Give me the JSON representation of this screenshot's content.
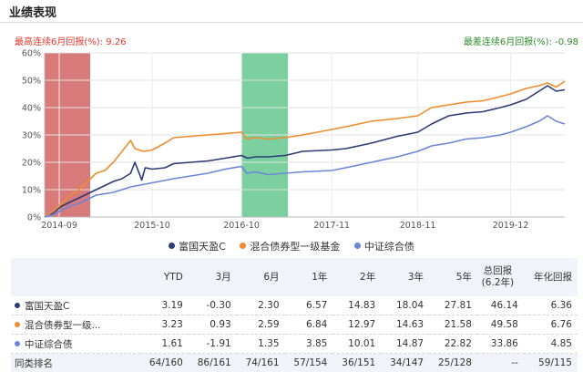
{
  "section_title": "业绩表现",
  "best_streak": {
    "label": "最高连续6月回报(%):",
    "value": "9.26"
  },
  "worst_streak": {
    "label": "最差连续6月回报(%):",
    "value": "-0.98"
  },
  "colors": {
    "fund": "#2c3a75",
    "category": "#f08c2e",
    "index": "#6b86d6",
    "best_band": "#d97a7a",
    "worst_band": "#7ccf9f"
  },
  "chart_data": {
    "type": "line",
    "title": "",
    "xlabel": "",
    "ylabel": "",
    "xlim": [
      2014.5,
      2020.55
    ],
    "ylim": [
      0,
      60
    ],
    "y_ticks": [
      0,
      10,
      20,
      30,
      40,
      50,
      60
    ],
    "y_tick_labels": [
      "0%",
      "10%",
      "20%",
      "30%",
      "40%",
      "50%",
      "60%"
    ],
    "x_ticks": [
      2014.67,
      2015.75,
      2016.79,
      2017.84,
      2018.84,
      2019.92
    ],
    "x_tick_labels": [
      "2014-09",
      "2015-10",
      "2016-10",
      "2017-11",
      "2018-11",
      "2019-12"
    ],
    "grid": true,
    "legend_position": "bottom",
    "highlight_bands": [
      {
        "kind": "best",
        "x_start": 2014.5,
        "x_end": 2015.03
      },
      {
        "kind": "worst",
        "x_start": 2016.79,
        "x_end": 2017.33
      }
    ],
    "series": [
      {
        "name": "富国天盈C",
        "color_key": "fund",
        "points": [
          [
            2014.5,
            0
          ],
          [
            2014.6,
            1.5
          ],
          [
            2014.7,
            4
          ],
          [
            2014.8,
            5.5
          ],
          [
            2014.9,
            7
          ],
          [
            2015.0,
            8.5
          ],
          [
            2015.1,
            10
          ],
          [
            2015.2,
            11.5
          ],
          [
            2015.3,
            13
          ],
          [
            2015.4,
            14
          ],
          [
            2015.5,
            16
          ],
          [
            2015.55,
            20
          ],
          [
            2015.6,
            16
          ],
          [
            2015.63,
            13.5
          ],
          [
            2015.67,
            18
          ],
          [
            2015.75,
            17.5
          ],
          [
            2015.9,
            18
          ],
          [
            2016.0,
            19.5
          ],
          [
            2016.2,
            20
          ],
          [
            2016.4,
            20.5
          ],
          [
            2016.6,
            21.5
          ],
          [
            2016.79,
            22.5
          ],
          [
            2016.86,
            21.5
          ],
          [
            2016.95,
            22
          ],
          [
            2017.1,
            22
          ],
          [
            2017.3,
            22.5
          ],
          [
            2017.5,
            24
          ],
          [
            2017.84,
            24.5
          ],
          [
            2018.0,
            25
          ],
          [
            2018.3,
            27
          ],
          [
            2018.6,
            29.5
          ],
          [
            2018.84,
            31
          ],
          [
            2019.0,
            34
          ],
          [
            2019.2,
            37
          ],
          [
            2019.4,
            38
          ],
          [
            2019.6,
            38.5
          ],
          [
            2019.8,
            40
          ],
          [
            2019.92,
            41
          ],
          [
            2020.1,
            43
          ],
          [
            2020.25,
            46
          ],
          [
            2020.35,
            48
          ],
          [
            2020.45,
            46
          ],
          [
            2020.55,
            46.5
          ]
        ]
      },
      {
        "name": "混合债券型一级基金",
        "color_key": "category",
        "points": [
          [
            2014.5,
            0
          ],
          [
            2014.6,
            2
          ],
          [
            2014.7,
            5
          ],
          [
            2014.8,
            8
          ],
          [
            2014.9,
            10
          ],
          [
            2015.0,
            13
          ],
          [
            2015.1,
            16
          ],
          [
            2015.2,
            17
          ],
          [
            2015.3,
            20
          ],
          [
            2015.4,
            24
          ],
          [
            2015.5,
            28
          ],
          [
            2015.55,
            25
          ],
          [
            2015.65,
            24
          ],
          [
            2015.75,
            24.5
          ],
          [
            2015.9,
            27
          ],
          [
            2016.0,
            29
          ],
          [
            2016.2,
            29.5
          ],
          [
            2016.4,
            30
          ],
          [
            2016.6,
            30.5
          ],
          [
            2016.79,
            31
          ],
          [
            2016.85,
            28.5
          ],
          [
            2016.95,
            29
          ],
          [
            2017.1,
            28.5
          ],
          [
            2017.3,
            29
          ],
          [
            2017.5,
            30
          ],
          [
            2017.84,
            32
          ],
          [
            2018.0,
            33
          ],
          [
            2018.3,
            35
          ],
          [
            2018.6,
            36
          ],
          [
            2018.84,
            37
          ],
          [
            2019.0,
            40
          ],
          [
            2019.2,
            41
          ],
          [
            2019.4,
            42
          ],
          [
            2019.6,
            42.5
          ],
          [
            2019.8,
            44
          ],
          [
            2019.92,
            45
          ],
          [
            2020.1,
            47
          ],
          [
            2020.25,
            48
          ],
          [
            2020.35,
            49
          ],
          [
            2020.45,
            47.5
          ],
          [
            2020.55,
            49.6
          ]
        ]
      },
      {
        "name": "中证综合债",
        "color_key": "index",
        "points": [
          [
            2014.5,
            0
          ],
          [
            2014.6,
            0.8
          ],
          [
            2014.7,
            2.5
          ],
          [
            2014.8,
            4
          ],
          [
            2014.9,
            5
          ],
          [
            2015.0,
            6.5
          ],
          [
            2015.1,
            8
          ],
          [
            2015.3,
            9
          ],
          [
            2015.5,
            11
          ],
          [
            2015.75,
            12.5
          ],
          [
            2016.0,
            14
          ],
          [
            2016.2,
            15
          ],
          [
            2016.4,
            16
          ],
          [
            2016.6,
            17.5
          ],
          [
            2016.79,
            18.5
          ],
          [
            2016.85,
            16
          ],
          [
            2016.95,
            16.5
          ],
          [
            2017.1,
            15.5
          ],
          [
            2017.3,
            16
          ],
          [
            2017.5,
            16.5
          ],
          [
            2017.84,
            17
          ],
          [
            2018.0,
            18
          ],
          [
            2018.3,
            20
          ],
          [
            2018.6,
            22
          ],
          [
            2018.84,
            24
          ],
          [
            2019.0,
            26
          ],
          [
            2019.2,
            27
          ],
          [
            2019.4,
            28.5
          ],
          [
            2019.6,
            29
          ],
          [
            2019.8,
            30
          ],
          [
            2019.92,
            31
          ],
          [
            2020.1,
            33
          ],
          [
            2020.25,
            35
          ],
          [
            2020.35,
            37
          ],
          [
            2020.45,
            35
          ],
          [
            2020.55,
            34
          ]
        ]
      }
    ]
  },
  "table": {
    "headers": [
      "",
      "YTD",
      "3月",
      "6月",
      "1年",
      "2年",
      "3年",
      "5年",
      "总回报\n(6.2年)",
      "年化回报"
    ],
    "rows": [
      {
        "name": "富国天盈C",
        "color_key": "fund",
        "values": [
          "3.19",
          "-0.30",
          "2.30",
          "6.57",
          "14.83",
          "18.04",
          "27.81",
          "46.14",
          "6.36"
        ]
      },
      {
        "name": "混合债券型一级...",
        "color_key": "category",
        "values": [
          "3.23",
          "0.93",
          "2.59",
          "6.84",
          "12.97",
          "14.63",
          "21.58",
          "49.58",
          "6.76"
        ]
      },
      {
        "name": "中证综合债",
        "color_key": "index",
        "values": [
          "1.61",
          "-1.91",
          "1.35",
          "3.85",
          "10.01",
          "14.87",
          "22.82",
          "33.86",
          "4.85"
        ]
      }
    ],
    "rank_row": {
      "name": "同类排名",
      "values": [
        "64/160",
        "86/161",
        "74/161",
        "57/154",
        "36/151",
        "34/147",
        "25/128",
        "--",
        "59/115"
      ]
    }
  }
}
